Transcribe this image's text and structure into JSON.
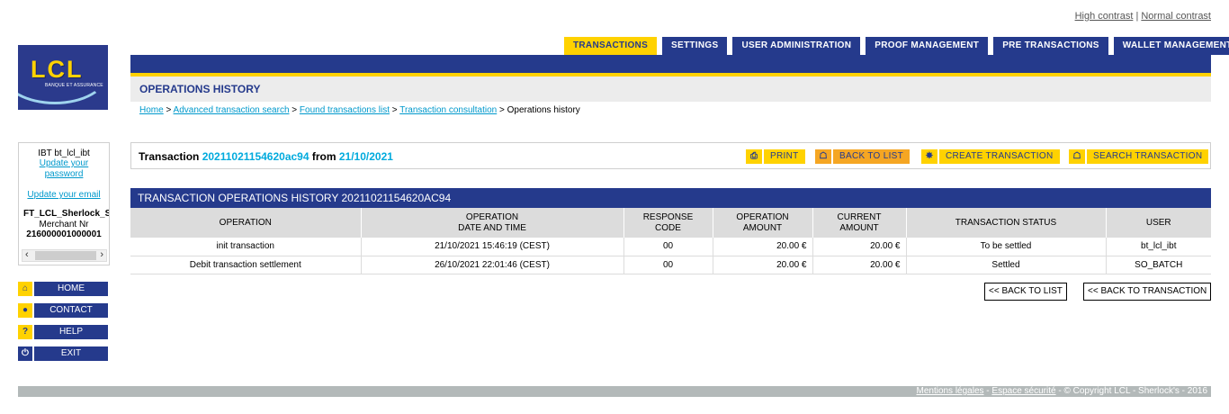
{
  "contrast": {
    "high": "High contrast",
    "sep": "|",
    "normal": "Normal contrast"
  },
  "logo": {
    "text": "LCL",
    "sub": "BANQUE ET ASSURANCE"
  },
  "tabs": [
    {
      "label": "TRANSACTIONS",
      "active": true
    },
    {
      "label": "SETTINGS"
    },
    {
      "label": "USER ADMINISTRATION"
    },
    {
      "label": "PROOF MANAGEMENT"
    },
    {
      "label": "PRE TRANSACTIONS"
    },
    {
      "label": "WALLET MANAGEMENT"
    }
  ],
  "page_title": "OPERATIONS HISTORY",
  "breadcrumb": [
    {
      "label": "Home",
      "link": true
    },
    {
      "label": "Advanced transaction search",
      "link": true
    },
    {
      "label": "Found transactions list",
      "link": true
    },
    {
      "label": "Transaction consultation",
      "link": true
    },
    {
      "label": "Operations history",
      "link": false
    }
  ],
  "breadcrumb_sep": " > ",
  "sidebar": {
    "user": "IBT bt_lcl_ibt",
    "update_password": "Update your password",
    "update_email": "Update your email",
    "merchant_id": "FT_LCL_Sherlock_S",
    "merchant_label": "Merchant Nr",
    "merchant_number": "216000001000001",
    "nav": [
      {
        "label": "HOME",
        "icon": "home-icon"
      },
      {
        "label": "CONTACT",
        "icon": "speech-bubble-icon"
      },
      {
        "label": "HELP",
        "icon": "question-mark-icon"
      },
      {
        "label": "EXIT",
        "icon": "exit-icon"
      }
    ]
  },
  "transaction": {
    "prefix": "Transaction",
    "id": "20211021154620ac94",
    "from_label": "from",
    "date": "21/10/2021"
  },
  "actions": {
    "print": "PRINT",
    "back_to_list": "BACK TO LIST",
    "create": "CREATE TRANSACTION",
    "search": "SEARCH TRANSACTION"
  },
  "section_title": "TRANSACTION OPERATIONS HISTORY 20211021154620AC94",
  "table": {
    "headers": [
      [
        "OPERATION"
      ],
      [
        "OPERATION",
        "DATE AND TIME"
      ],
      [
        "RESPONSE",
        "CODE"
      ],
      [
        "OPERATION",
        "AMOUNT"
      ],
      [
        "CURRENT",
        "AMOUNT"
      ],
      [
        "TRANSACTION STATUS"
      ],
      [
        "USER"
      ]
    ],
    "rows": [
      {
        "operation": "init transaction",
        "datetime": "21/10/2021 15:46:19 (CEST)",
        "code": "00",
        "op_amount": "20.00  €",
        "cur_amount": "20.00  €",
        "status": "To be settled",
        "user": "bt_lcl_ibt"
      },
      {
        "operation": "Debit transaction settlement",
        "datetime": "26/10/2021 22:01:46 (CEST)",
        "code": "00",
        "op_amount": "20.00  €",
        "cur_amount": "20.00  €",
        "status": "Settled",
        "user": "SO_BATCH"
      }
    ]
  },
  "bottom_buttons": {
    "back_to_list": "<< BACK TO LIST",
    "back_to_transaction": "<< BACK TO TRANSACTION"
  },
  "footer": {
    "legal": "Mentions légales",
    "security": "Espace sécurité",
    "copyright": "© Copyright LCL - Sherlock's - 2016"
  }
}
